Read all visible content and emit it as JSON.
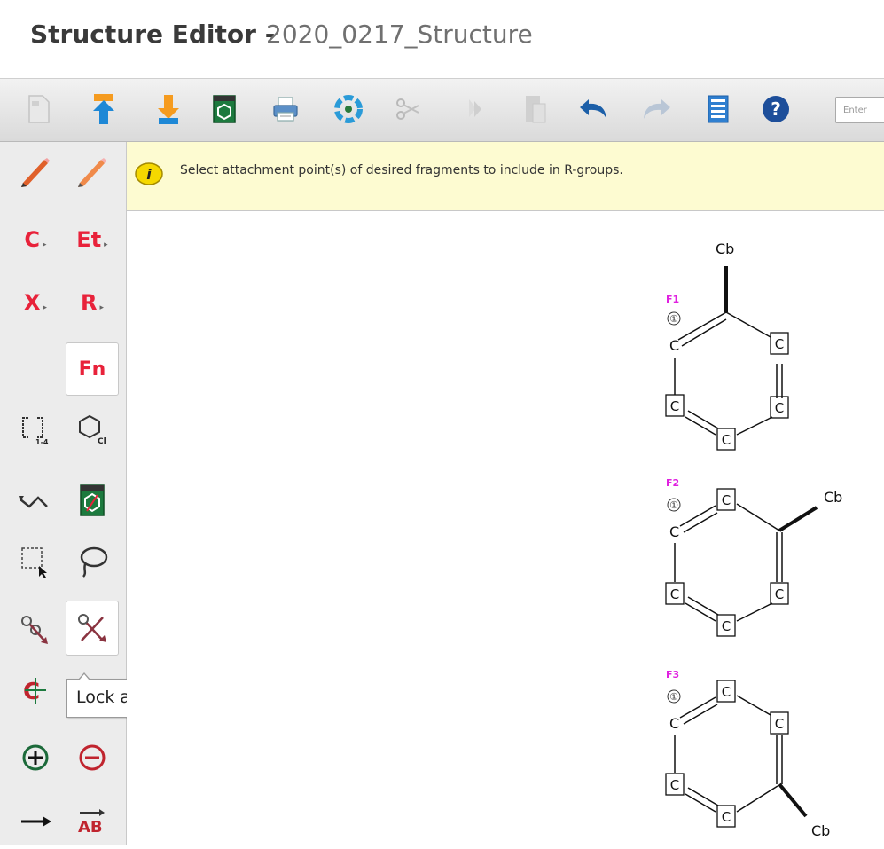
{
  "title": {
    "app": "Structure Editor - ",
    "document": "2020_0217_Structure"
  },
  "toolbar": {
    "buttons": [
      {
        "name": "new-document-icon"
      },
      {
        "name": "import-icon"
      },
      {
        "name": "export-icon"
      },
      {
        "name": "template-icon"
      },
      {
        "name": "print-icon"
      },
      {
        "name": "clean-structure-icon"
      },
      {
        "name": "cut-icon"
      },
      {
        "name": "copy-icon"
      },
      {
        "name": "paste-icon"
      },
      {
        "name": "undo-icon"
      },
      {
        "name": "redo-icon"
      },
      {
        "name": "properties-icon"
      },
      {
        "name": "help-icon"
      }
    ],
    "search_placeholder": "Enter"
  },
  "sidebar": {
    "carbon_label": "C",
    "ethyl_label": "Et",
    "halogen_label": "X",
    "rgroup_label": "R",
    "fn_label": "Fn",
    "bracket_sub": "1-4",
    "ring_sub": "Cl",
    "ab_label": "AB"
  },
  "notice": {
    "text": "Select attachment point(s) of desired fragments to include in R-groups."
  },
  "tooltip": {
    "text": "Lock atoms"
  },
  "molecules": [
    {
      "label": "F1",
      "attach": "①",
      "c_top": "C",
      "sub": "Cb",
      "atoms": [
        "C",
        "C",
        "C",
        "C",
        "C"
      ]
    },
    {
      "label": "F2",
      "attach": "①",
      "c_top": "C",
      "sub": "Cb",
      "atoms": [
        "C",
        "C",
        "C",
        "C",
        "C"
      ]
    },
    {
      "label": "F3",
      "attach": "①",
      "c_top": "C",
      "sub": "Cb",
      "atoms": [
        "C",
        "C",
        "C",
        "C",
        "C"
      ]
    }
  ],
  "colors": {
    "element_red": "#e8223a",
    "fragment_magenta": "#e020e0",
    "notice_bg": "#fdfbd1"
  }
}
